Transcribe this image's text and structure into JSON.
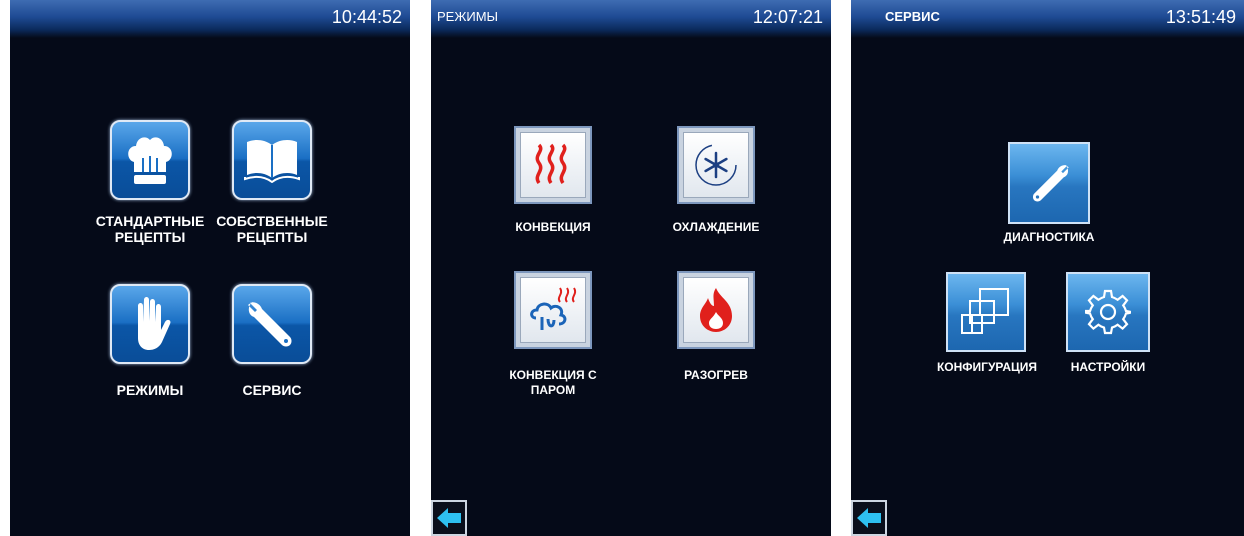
{
  "screen_main": {
    "time": "10:44:52",
    "tiles": [
      {
        "label_line1": "СТАНДАРТНЫЕ",
        "label_line2": "РЕЦЕПТЫ",
        "icon": "chef-hat-icon"
      },
      {
        "label_line1": "СОБСТВЕННЫЕ",
        "label_line2": "РЕЦЕПТЫ",
        "icon": "book-icon"
      },
      {
        "label_line1": "РЕЖИМЫ",
        "label_line2": "",
        "icon": "hand-icon"
      },
      {
        "label_line1": "СЕРВИС",
        "label_line2": "",
        "icon": "wrench-icon"
      }
    ]
  },
  "screen_modes": {
    "title": "РЕЖИМЫ",
    "time": "12:07:21",
    "tiles": [
      {
        "label_line1": "КОНВЕКЦИЯ",
        "label_line2": "",
        "icon": "convection-heat-icon"
      },
      {
        "label_line1": "ОХЛАЖДЕНИЕ",
        "label_line2": "",
        "icon": "cooling-fan-icon"
      },
      {
        "label_line1": "КОНВЕКЦИЯ С",
        "label_line2": "ПАРОМ",
        "icon": "steam-convection-icon"
      },
      {
        "label_line1": "РАЗОГРЕВ",
        "label_line2": "",
        "icon": "flame-icon"
      }
    ],
    "back_icon": "back-arrow-icon"
  },
  "screen_service": {
    "title": "СЕРВИС",
    "time": "13:51:49",
    "tiles": [
      {
        "label_line1": "ДИАГНОСТИКА",
        "icon": "wrench-icon"
      },
      {
        "label_line1": "КОНФИГУРАЦИЯ",
        "icon": "configuration-windows-icon"
      },
      {
        "label_line1": "НАСТРОЙКИ",
        "icon": "gear-icon"
      }
    ],
    "back_icon": "back-arrow-icon"
  },
  "colors": {
    "background": "#050a18",
    "topbar": "#1e4a93",
    "tile_blue": "#1a6fc4",
    "back_arrow": "#2ec0f0",
    "heat_red": "#e0201c"
  }
}
